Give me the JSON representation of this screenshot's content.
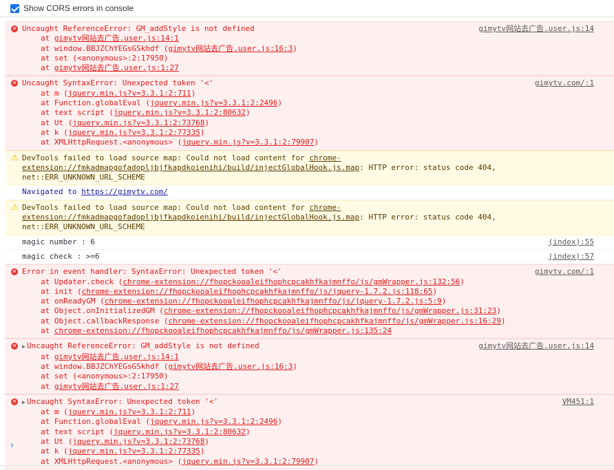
{
  "toolbar": {
    "cors_label": "Show CORS errors in console"
  },
  "messages": [
    {
      "type": "error",
      "head": "Uncaught ReferenceError: GM_addStyle is not defined",
      "source": "gimytv网站去广告.user.js:14",
      "stack": [
        {
          "pre": "at ",
          "link": "gimytv网站去广告.user.js:14:1",
          "post": ""
        },
        {
          "pre": "at window.BBJZChYEGsGSkhdf (",
          "link": "gimytv网站去广告.user.js:16:3",
          "post": ")"
        },
        {
          "pre": "at set (<anonymous>:2:17950)",
          "link": "",
          "post": ""
        },
        {
          "pre": "at ",
          "link": "gimytv网站去广告.user.js:1:27",
          "post": ""
        }
      ]
    },
    {
      "type": "error",
      "head": "Uncaught SyntaxError: Unexpected token '<'",
      "source": "gimytv.com/:1",
      "stack": [
        {
          "pre": "at m (",
          "link": "jquery.min.js?v=3.3.1:2:711",
          "post": ")"
        },
        {
          "pre": "at Function.globalEval (",
          "link": "jquery.min.js?v=3.3.1:2:2496",
          "post": ")"
        },
        {
          "pre": "at text script (",
          "link": "jquery.min.js?v=3.3.1:2:80632",
          "post": ")"
        },
        {
          "pre": "at Ut (",
          "link": "jquery.min.js?v=3.3.1:2:73768",
          "post": ")"
        },
        {
          "pre": "at k (",
          "link": "jquery.min.js?v=3.3.1:2:77335",
          "post": ")"
        },
        {
          "pre": "at XMLHttpRequest.<anonymous> (",
          "link": "jquery.min.js?v=3.3.1:2:79907",
          "post": ")"
        }
      ]
    },
    {
      "type": "warning",
      "text_pre": "DevTools failed to load source map: Could not load content for ",
      "link": "chrome-extension://fmkadmapgofadopljbjfkapdkoienihi/build/injectGlobalHook.js.map",
      "text_post": ": HTTP error: status code 404, net::ERR_UNKNOWN_URL_SCHEME"
    },
    {
      "type": "nav",
      "text": "Navigated to ",
      "link": "https://gimytv.com/"
    },
    {
      "type": "warning",
      "text_pre": "DevTools failed to load source map: Could not load content for ",
      "link": "chrome-extension://fmkadmapgofadopljbjfkapdkoienihi/build/injectGlobalHook.js.map",
      "text_post": ": HTTP error: status code 404, net::ERR_UNKNOWN_URL_SCHEME"
    },
    {
      "type": "info",
      "text": "magic number : 6",
      "source": "(index):55"
    },
    {
      "type": "info",
      "text": "magic check : >=6",
      "source": "(index):57"
    },
    {
      "type": "error",
      "head": "Error in event handler: SyntaxError: Unexpected token '<'",
      "source": "gimytv.com/:1",
      "stack": [
        {
          "pre": "at Updater.check (",
          "link": "chrome-extension://fhopckooaleifhophcpcakhfkajmnffo/js/gmWrapper.js:132:56",
          "post": ")"
        },
        {
          "pre": "at init (",
          "link": "chrome-extension://fhopckooaleifhophcpcakhfkajmnffo/js/jquery-1.7.2.js:118:65",
          "post": ")"
        },
        {
          "pre": "at onReadyGM (",
          "link": "chrome-extension://fhopckooaleifhophcpcakhfkajmnffo/js/jquery-1.7.2.js:5:9",
          "post": ")"
        },
        {
          "pre": "at Object.onInitializedGM (",
          "link": "chrome-extension://fhopckooaleifhophcpcakhfkajmnffo/js/gmWrapper.js:31:23",
          "post": ")"
        },
        {
          "pre": "at Object.callbackResponse (",
          "link": "chrome-extension://fhopckooaleifhophcpcakhfkajmnffo/js/gmWrapper.js:16:29",
          "post": ")"
        },
        {
          "pre": "at ",
          "link": "chrome-extension://fhopckooaleifhophcpcakhfkajmnffo/js/gmWrapper.js:135:24",
          "post": ""
        }
      ]
    },
    {
      "type": "error",
      "expandable": true,
      "head": "Uncaught ReferenceError: GM_addStyle is not defined",
      "source": "gimytv网站去广告.user.js:14",
      "stack": [
        {
          "pre": "at ",
          "link": "gimytv网站去广告.user.js:14:1",
          "post": ""
        },
        {
          "pre": "at window.BBJZChYEGsGSkhdf (",
          "link": "gimytv网站去广告.user.js:16:3",
          "post": ")"
        },
        {
          "pre": "at set (<anonymous>:2:17950)",
          "link": "",
          "post": ""
        },
        {
          "pre": "at ",
          "link": "gimytv网站去广告.user.js:1:27",
          "post": ""
        }
      ]
    },
    {
      "type": "error",
      "expandable": true,
      "head": "Uncaught SyntaxError: Unexpected token '<'",
      "source": "VM451:1",
      "stack": [
        {
          "pre": "at m (",
          "link": "jquery.min.js?v=3.3.1:2:711",
          "post": ")"
        },
        {
          "pre": "at Function.globalEval (",
          "link": "jquery.min.js?v=3.3.1:2:2496",
          "post": ")"
        },
        {
          "pre": "at text script (",
          "link": "jquery.min.js?v=3.3.1:2:80632",
          "post": ")"
        },
        {
          "pre": "at Ut (",
          "link": "jquery.min.js?v=3.3.1:2:73768",
          "post": ")"
        },
        {
          "pre": "at k (",
          "link": "jquery.min.js?v=3.3.1:2:77335",
          "post": ")"
        },
        {
          "pre": "at XMLHttpRequest.<anonymous> (",
          "link": "jquery.min.js?v=3.3.1:2:79907",
          "post": ")"
        }
      ]
    }
  ],
  "prompt": {
    "symbol": "›"
  },
  "icons": {
    "error": "error-icon",
    "warning": "warning-icon"
  }
}
